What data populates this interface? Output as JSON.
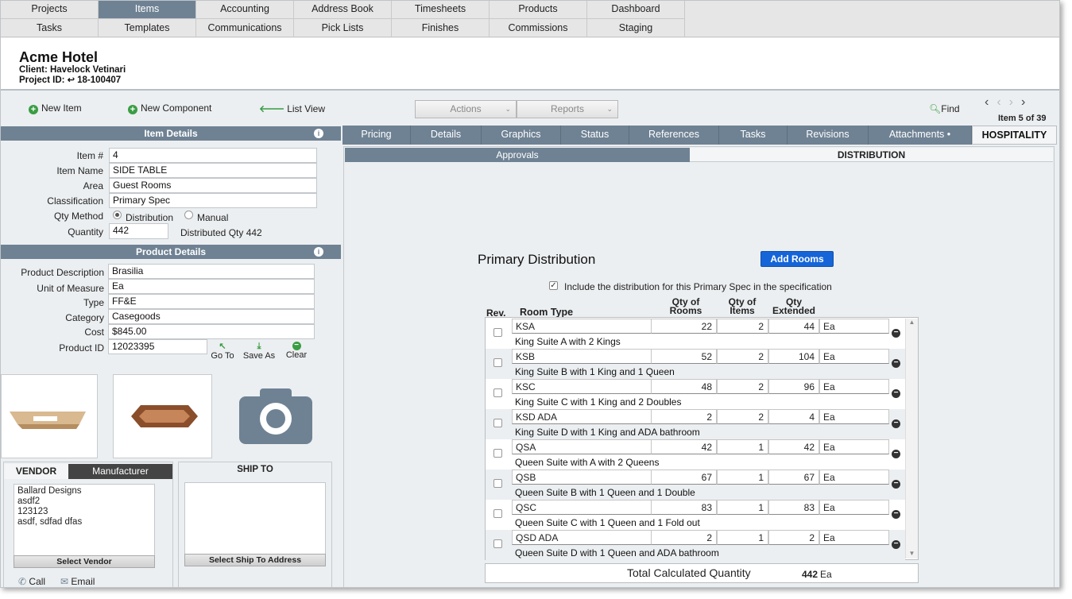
{
  "nav": {
    "row1": [
      "Projects",
      "Items",
      "Accounting",
      "Address Book",
      "Timesheets",
      "Products",
      "Dashboard"
    ],
    "row2": [
      "Tasks",
      "Templates",
      "Communications",
      "Pick Lists",
      "Finishes",
      "Commissions",
      "Staging"
    ],
    "active": "Items"
  },
  "header": {
    "title": "Acme Hotel",
    "client": "Client: Havelock Vetinari",
    "project_id_label": "Project ID:",
    "project_id": "18-100407"
  },
  "toolbar": {
    "new_item": "New Item",
    "new_component": "New Component",
    "list_view": "List View",
    "actions": "Actions",
    "reports": "Reports",
    "find": "Find",
    "item_counter": "Item 5 of 39"
  },
  "item_details": {
    "heading": "Item Details",
    "item_no_label": "Item #",
    "item_no": "4",
    "item_name_label": "Item Name",
    "item_name": "SIDE TABLE",
    "area_label": "Area",
    "area": "Guest Rooms",
    "classification_label": "Classification",
    "classification": "Primary Spec",
    "qty_method_label": "Qty Method",
    "qty_option1": "Distribution",
    "qty_option2": "Manual",
    "quantity_label": "Quantity",
    "quantity": "442",
    "distributed_qty": "Distributed Qty 442"
  },
  "product_details": {
    "heading": "Product Details",
    "description_label": "Product Description",
    "description": "Brasilia",
    "uom_label": "Unit of Measure",
    "uom": "Ea",
    "type_label": "Type",
    "type": "FF&E",
    "category_label": "Category",
    "category": "Casegoods",
    "cost_label": "Cost",
    "cost": "$845.00",
    "product_id_label": "Product ID",
    "product_id": "12023395",
    "go_to": "Go To",
    "save_as": "Save As",
    "clear": "Clear"
  },
  "vendor": {
    "tab_vendor": "VENDOR",
    "tab_manufacturer": "Manufacturer",
    "lines": [
      "Ballard Designs",
      "asdf2",
      "123123",
      "asdf, sdfad dfas"
    ],
    "select_vendor": "Select Vendor",
    "call": "Call",
    "email": "Email"
  },
  "ship_to": {
    "heading": "SHIP TO",
    "select_button": "Select Ship To Address"
  },
  "tabs": [
    "Pricing",
    "Details",
    "Graphics",
    "Status",
    "References",
    "Tasks",
    "Revisions",
    "Attachments •",
    "HOSPITALITY"
  ],
  "subtabs": [
    "Approvals",
    "DISTRIBUTION"
  ],
  "distribution": {
    "title": "Primary Distribution",
    "add_rooms": "Add Rooms",
    "include_text": "Include the distribution for this Primary Spec in the specification",
    "col_rev": "Rev.",
    "col_room_type": "Room Type",
    "col_qty_rooms": "Qty of Rooms",
    "col_qty_items": "Qty of Items",
    "col_qty_ext": "Qty Extended",
    "rows": [
      {
        "code": "KSA",
        "desc": "King Suite A with 2 Kings",
        "rooms": "22",
        "items": "2",
        "ext": "44",
        "unit": "Ea"
      },
      {
        "code": "KSB",
        "desc": "King Suite B with 1 King and 1 Queen",
        "rooms": "52",
        "items": "2",
        "ext": "104",
        "unit": "Ea"
      },
      {
        "code": "KSC",
        "desc": "King Suite C with 1 King and 2 Doubles",
        "rooms": "48",
        "items": "2",
        "ext": "96",
        "unit": "Ea"
      },
      {
        "code": "KSD ADA",
        "desc": "King Suite D with 1 King and  ADA bathroom",
        "rooms": "2",
        "items": "2",
        "ext": "4",
        "unit": "Ea"
      },
      {
        "code": "QSA",
        "desc": "Queen Suite with A with 2 Queens",
        "rooms": "42",
        "items": "1",
        "ext": "42",
        "unit": "Ea"
      },
      {
        "code": "QSB",
        "desc": "Queen Suite B with 1 Queen and 1 Double",
        "rooms": "67",
        "items": "1",
        "ext": "67",
        "unit": "Ea"
      },
      {
        "code": "QSC",
        "desc": "Queen Suite C with 1 Queen and 1 Fold out",
        "rooms": "83",
        "items": "1",
        "ext": "83",
        "unit": "Ea"
      },
      {
        "code": "QSD ADA",
        "desc": "Queen Suite D with 1 Queen and ADA bathroom",
        "rooms": "2",
        "items": "1",
        "ext": "2",
        "unit": "Ea"
      }
    ],
    "total_label": "Total Calculated Quantity",
    "total_value": "442",
    "total_unit": "Ea"
  },
  "colors": {
    "accent": "#6f8294",
    "primary_button": "#1565d8",
    "green": "#3a9d44"
  }
}
